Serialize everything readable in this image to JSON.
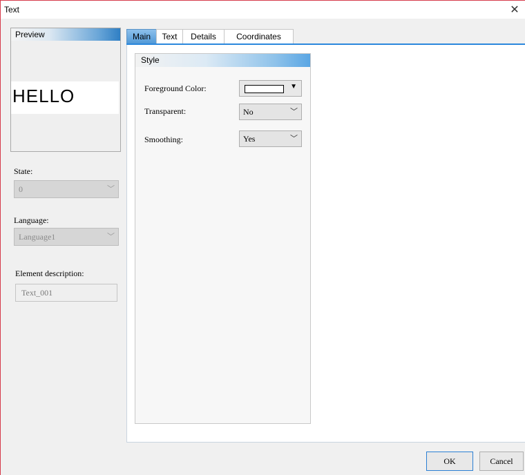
{
  "window": {
    "title": "Text",
    "close_glyph": "✕"
  },
  "preview": {
    "header": "Preview",
    "sample_text": "HELLO"
  },
  "state": {
    "label": "State:",
    "value": "0"
  },
  "language": {
    "label": "Language:",
    "value": "Language1"
  },
  "description": {
    "label": "Element description:",
    "value": "Text_001"
  },
  "tabs": [
    {
      "label": "Main",
      "active": true
    },
    {
      "label": "Text",
      "active": false
    },
    {
      "label": "Details",
      "active": false
    },
    {
      "label": "Coordinates",
      "active": false
    }
  ],
  "style": {
    "header": "Style",
    "foreground_label": "Foreground Color:",
    "foreground_color": "#ffffff",
    "transparent_label": "Transparent:",
    "transparent_value": "No",
    "smoothing_label": "Smoothing:",
    "smoothing_value": "Yes"
  },
  "buttons": {
    "ok": "OK",
    "cancel": "Cancel"
  },
  "icons": {
    "chevron": "chevron-down-icon",
    "close": "close-icon",
    "triangle": "triangle-down-icon"
  },
  "colors": {
    "accent": "#2a87dc",
    "tab_active": "#5a9fd9"
  }
}
